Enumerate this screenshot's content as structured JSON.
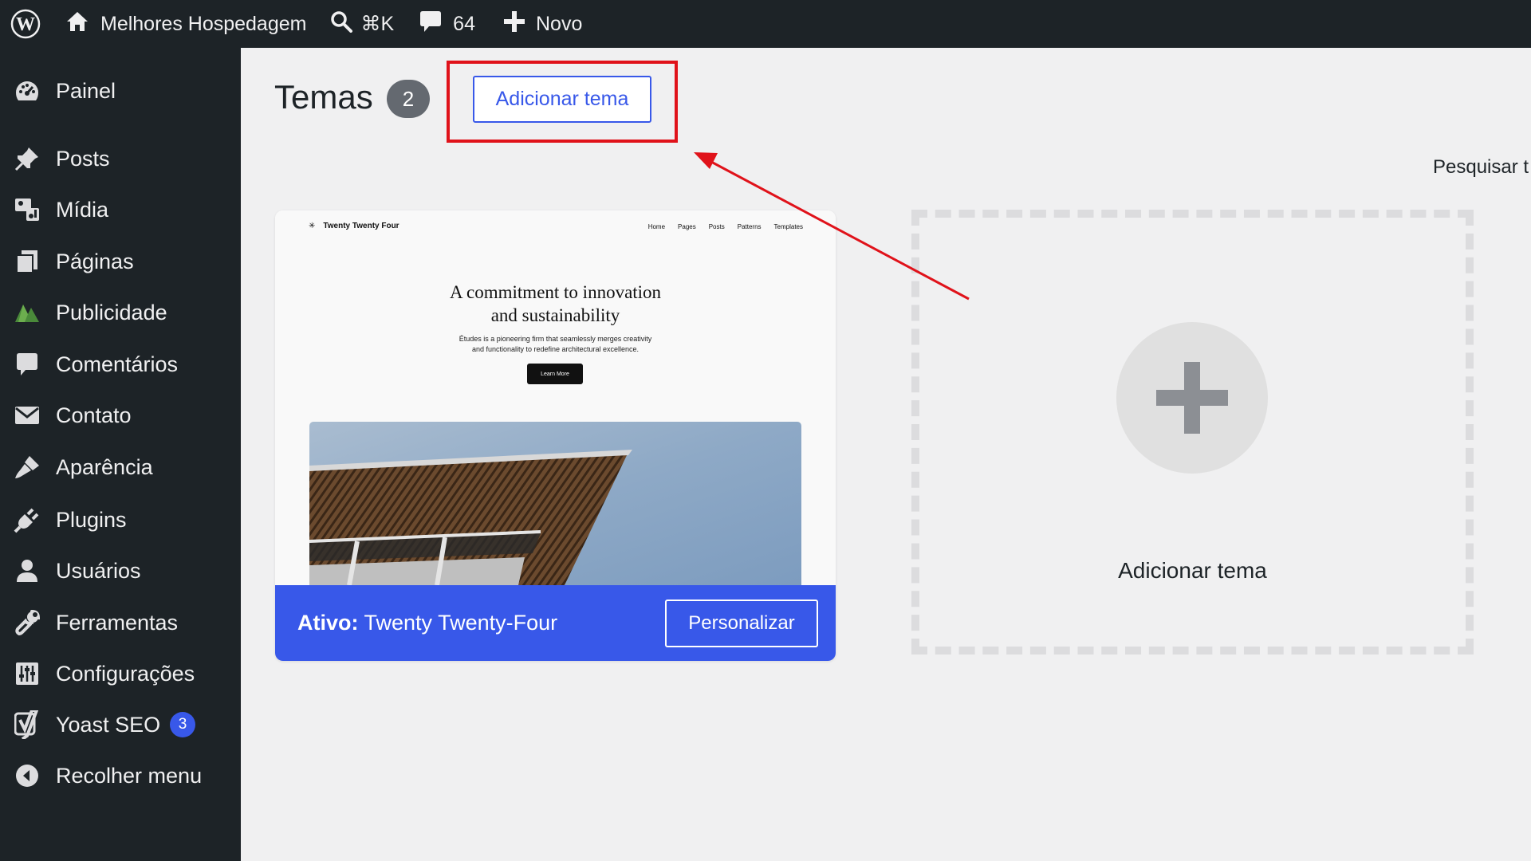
{
  "adminbar": {
    "site_name": "Melhores Hospedagem",
    "search_shortcut": "⌘K",
    "comments_count": "64",
    "new_label": "Novo"
  },
  "sidebar": {
    "items": [
      {
        "label": "Painel",
        "icon": "dashboard-icon"
      },
      {
        "label": "Posts",
        "icon": "pin-icon"
      },
      {
        "label": "Mídia",
        "icon": "media-icon"
      },
      {
        "label": "Páginas",
        "icon": "pages-icon"
      },
      {
        "label": "Publicidade",
        "icon": "ads-icon"
      },
      {
        "label": "Comentários",
        "icon": "comment-icon"
      },
      {
        "label": "Contato",
        "icon": "envelope-icon"
      },
      {
        "label": "Aparência",
        "icon": "brush-icon"
      },
      {
        "label": "Plugins",
        "icon": "plug-icon"
      },
      {
        "label": "Usuários",
        "icon": "user-icon"
      },
      {
        "label": "Ferramentas",
        "icon": "wrench-icon"
      },
      {
        "label": "Configurações",
        "icon": "settings-icon"
      },
      {
        "label": "Yoast SEO",
        "icon": "yoast-icon",
        "badge": "3"
      },
      {
        "label": "Recolher menu",
        "icon": "collapse-icon"
      }
    ]
  },
  "main": {
    "title": "Temas",
    "count": "2",
    "add_button": "Adicionar tema",
    "search_label": "Pesquisar t"
  },
  "theme_card": {
    "preview": {
      "site_title": "Twenty Twenty Four",
      "nav": [
        "Home",
        "Pages",
        "Posts",
        "Patterns",
        "Templates"
      ],
      "headline_1": "A commitment to innovation",
      "headline_2": "and sustainability",
      "sub_1": "Études is a pioneering firm that seamlessly merges creativity",
      "sub_2": "and functionality to redefine architectural excellence.",
      "button": "Learn More"
    },
    "active_prefix": "Ativo:",
    "theme_name": "Twenty Twenty-Four",
    "customize_button": "Personalizar"
  },
  "add_new_card": {
    "label": "Adicionar tema"
  },
  "colors": {
    "admin_dark": "#1d2327",
    "accent_blue": "#3858e9",
    "highlight_red": "#e0121a",
    "background": "#f0f0f1"
  }
}
